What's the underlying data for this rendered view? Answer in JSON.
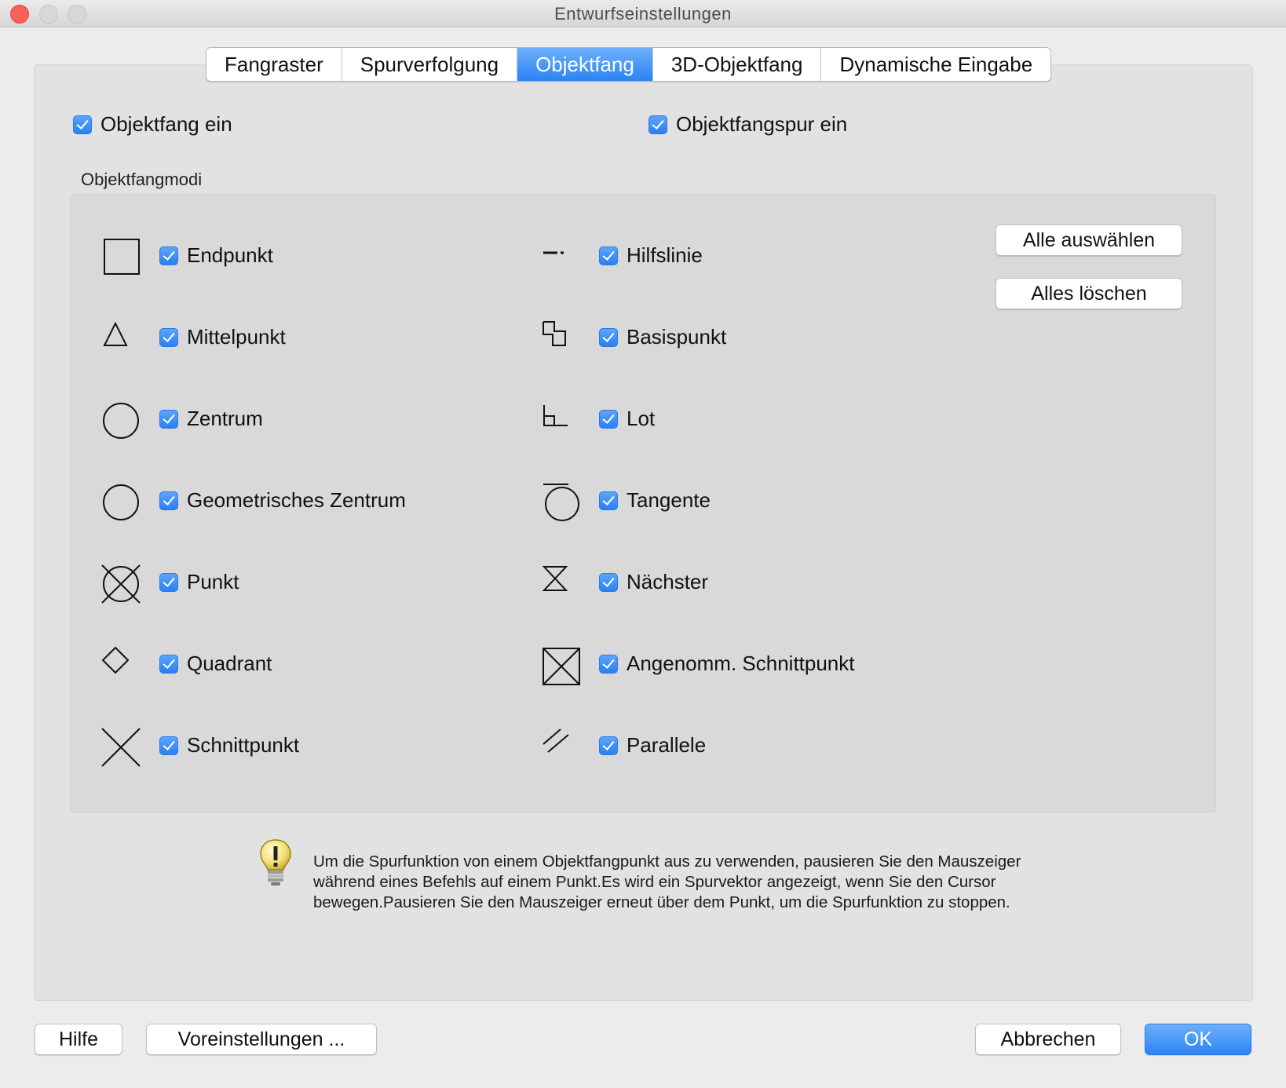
{
  "window": {
    "title": "Entwurfseinstellungen"
  },
  "tabs": [
    {
      "label": "Fangraster"
    },
    {
      "label": "Spurverfolgung"
    },
    {
      "label": "Objektfang"
    },
    {
      "label": "3D-Objektfang"
    },
    {
      "label": "Dynamische Eingabe"
    }
  ],
  "active_tab": "Objektfang",
  "top_options": {
    "objektfang_ein": {
      "label": "Objektfang ein",
      "checked": true
    },
    "objektfangspur_ein": {
      "label": "Objektfangspur ein",
      "checked": true
    }
  },
  "modes_group": {
    "label": "Objektfangmodi",
    "left": [
      {
        "label": "Endpunkt",
        "icon": "square-icon",
        "checked": true
      },
      {
        "label": "Mittelpunkt",
        "icon": "triangle-icon",
        "checked": true
      },
      {
        "label": "Zentrum",
        "icon": "circle-icon",
        "checked": true
      },
      {
        "label": "Geometrisches Zentrum",
        "icon": "circle-icon",
        "checked": true
      },
      {
        "label": "Punkt",
        "icon": "circle-cross-icon",
        "checked": true
      },
      {
        "label": "Quadrant",
        "icon": "diamond-icon",
        "checked": true
      },
      {
        "label": "Schnittpunkt",
        "icon": "x-cross-icon",
        "checked": true
      }
    ],
    "right": [
      {
        "label": "Hilfslinie",
        "icon": "extension-icon",
        "checked": true
      },
      {
        "label": "Basispunkt",
        "icon": "insertion-icon",
        "checked": true
      },
      {
        "label": "Lot",
        "icon": "perpendicular-icon",
        "checked": true
      },
      {
        "label": "Tangente",
        "icon": "tangent-icon",
        "checked": true
      },
      {
        "label": "Nächster",
        "icon": "hourglass-icon",
        "checked": true
      },
      {
        "label": "Angenomm. Schnittpunkt",
        "icon": "boxed-x-icon",
        "checked": true
      },
      {
        "label": "Parallele",
        "icon": "parallel-icon",
        "checked": true
      }
    ],
    "select_all_label": "Alle auswählen",
    "clear_all_label": "Alles löschen"
  },
  "hint": {
    "icon": "lightbulb-icon",
    "text": "Um die Spurfunktion von einem Objektfangpunkt aus zu verwenden, pausieren Sie den Mauszeiger während eines Befehls auf einem Punkt.Es wird ein Spurvektor angezeigt, wenn Sie den Cursor bewegen.Pausieren Sie den Mauszeiger erneut über dem Punkt, um die Spurfunktion zu stoppen."
  },
  "footer": {
    "help_label": "Hilfe",
    "defaults_label": "Voreinstellungen ...",
    "cancel_label": "Abbrechen",
    "ok_label": "OK"
  },
  "colors": {
    "accent": "#2c83f5",
    "close_button": "#fc605b"
  }
}
